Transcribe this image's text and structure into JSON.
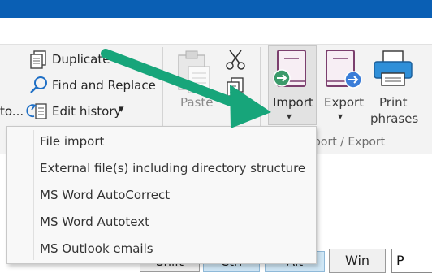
{
  "ribbon": {
    "duplicate_label": "Duplicate",
    "find_replace_label": "Find and Replace",
    "edit_history_label": "Edit history",
    "edit_history_arrow": "▾",
    "truncated_left_label": "to...",
    "paste_label": "Paste",
    "import_label": "Import",
    "import_arrow": "▾",
    "export_label": "Export",
    "export_arrow": "▾",
    "print_line1": "Print",
    "print_line2": "phrases",
    "group_label_partial": "port / Export"
  },
  "dropdown": {
    "items": [
      "File import",
      "External file(s) including directory structure",
      "MS Word AutoCorrect",
      "MS Word Autotext",
      "MS Outlook emails"
    ]
  },
  "keyboard": {
    "shift": "Shift",
    "ctrl": "Ctrl",
    "alt": "Alt",
    "win": "Win"
  },
  "hotkey_value": "P",
  "colors": {
    "title_bar": "#0a5fb4",
    "annotation_arrow": "#17a57a",
    "import_icon_accent": "#7b3f6e",
    "export_icon_badge": "#3b7dd8"
  }
}
